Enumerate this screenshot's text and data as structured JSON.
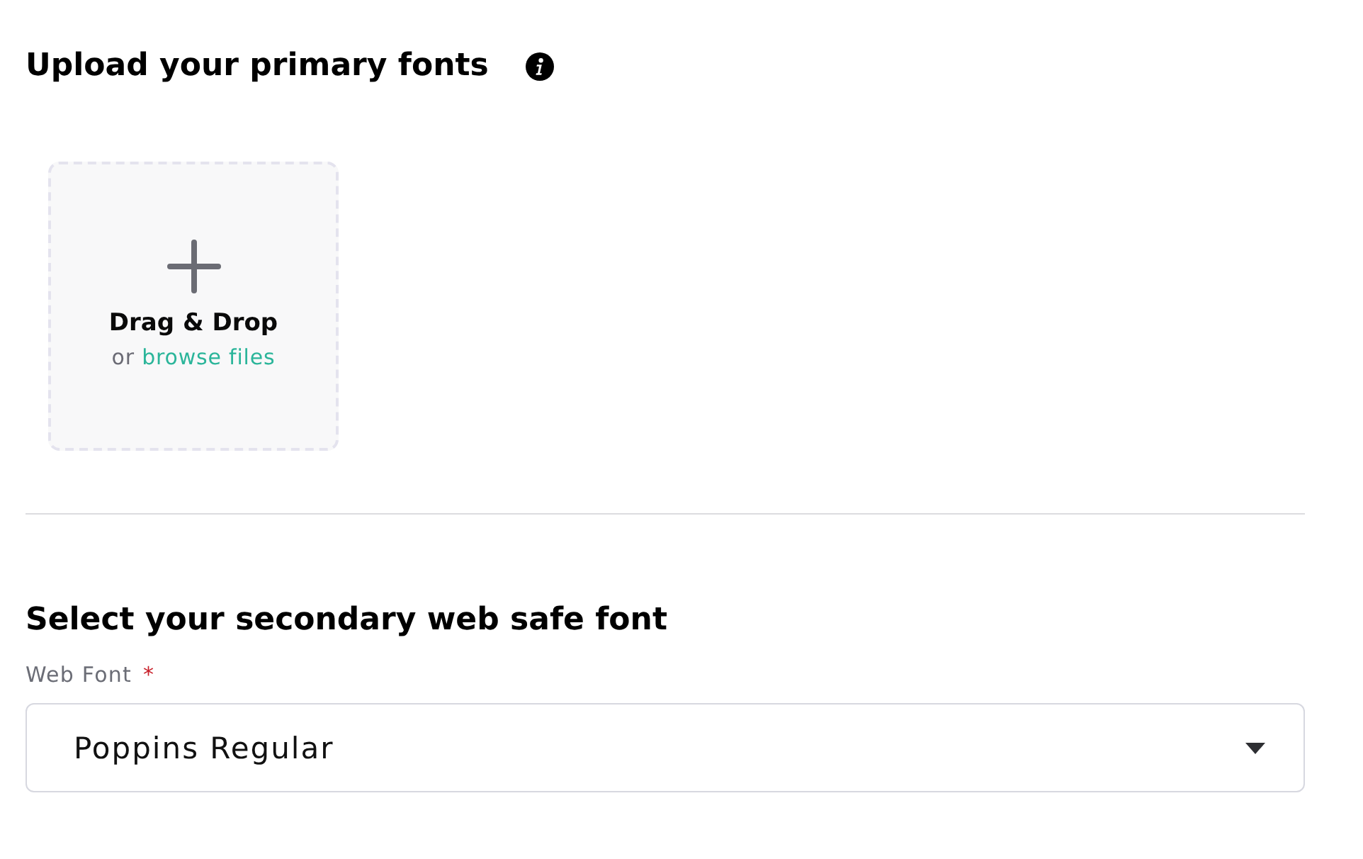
{
  "upload_section": {
    "title": "Upload your primary fonts",
    "dropzone": {
      "title": "Drag & Drop",
      "prefix": "or",
      "link": "browse files"
    }
  },
  "font_section": {
    "title": "Select your secondary web safe font",
    "field": {
      "label": "Web Font",
      "required_mark": "*",
      "value": "Poppins Regular"
    }
  }
}
